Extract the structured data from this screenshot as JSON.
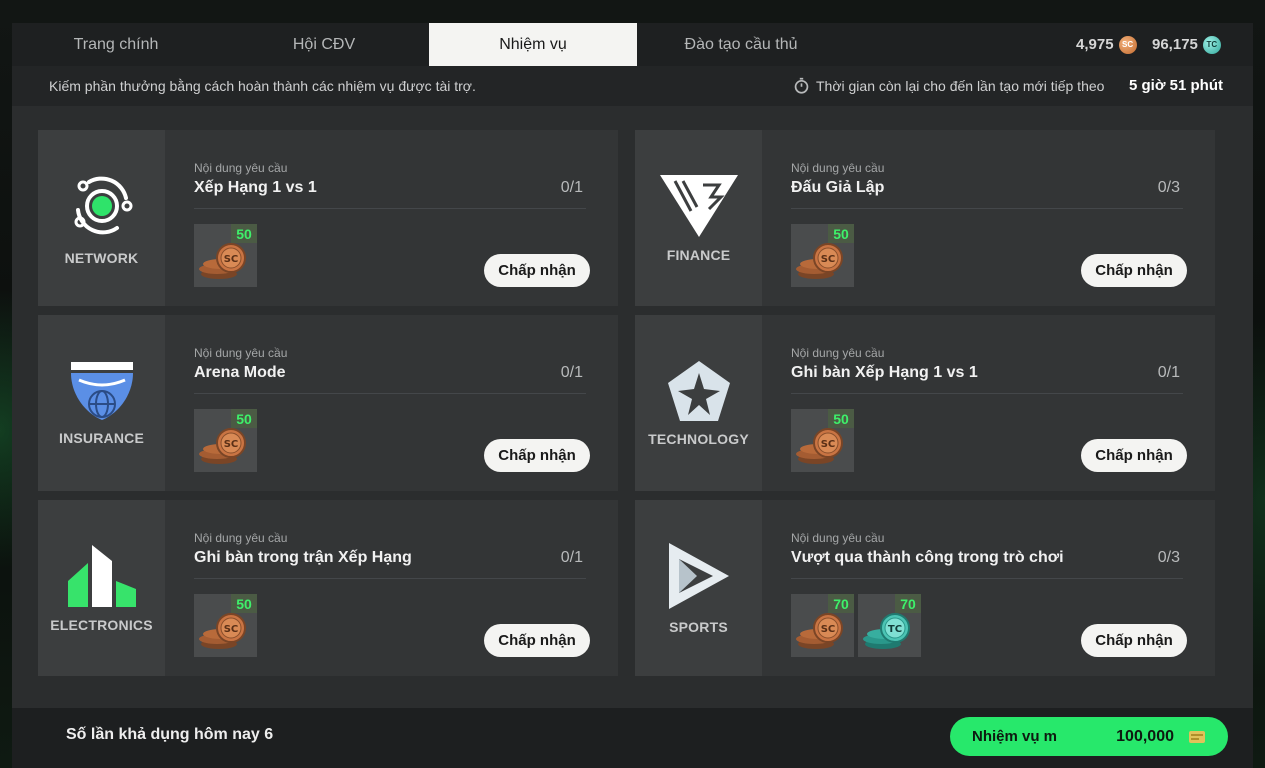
{
  "tabs": [
    {
      "label": "Trang chính"
    },
    {
      "label": "Hội CĐV"
    },
    {
      "label": "Nhiệm vụ"
    },
    {
      "label": "Đào tạo cầu thủ"
    }
  ],
  "active_tab": "Nhiệm vụ",
  "currency": {
    "sc_amount": "4,975",
    "sc_icon": "sc-coin-icon",
    "sc_symbol": "SC",
    "tc_amount": "96,175",
    "tc_icon": "tc-coin-icon",
    "tc_symbol": "TC"
  },
  "info": {
    "description": "Kiếm phần thưởng bằng cách hoàn thành các nhiệm vụ được tài trợ.",
    "timer_label": "Thời gian còn lại cho đến lần tạo mới tiếp theo",
    "timer_value": "5 giờ 51 phút"
  },
  "missions": [
    {
      "sponsor": "NETWORK",
      "req_label": "Nội dung yêu cầu",
      "title": "Xếp Hạng 1 vs 1",
      "progress": "0/1",
      "rewards": [
        {
          "type": "SC",
          "amount": "50"
        }
      ],
      "accept_label": "Chấp nhận"
    },
    {
      "sponsor": "FINANCE",
      "req_label": "Nội dung yêu cầu",
      "title": "Đấu Giả Lập",
      "progress": "0/3",
      "rewards": [
        {
          "type": "SC",
          "amount": "50"
        }
      ],
      "accept_label": "Chấp nhận"
    },
    {
      "sponsor": "INSURANCE",
      "req_label": "Nội dung yêu cầu",
      "title": "Arena Mode",
      "progress": "0/1",
      "rewards": [
        {
          "type": "SC",
          "amount": "50"
        }
      ],
      "accept_label": "Chấp nhận"
    },
    {
      "sponsor": "TECHNOLOGY",
      "req_label": "Nội dung yêu cầu",
      "title": "Ghi bàn Xếp Hạng 1 vs 1",
      "progress": "0/1",
      "rewards": [
        {
          "type": "SC",
          "amount": "50"
        }
      ],
      "accept_label": "Chấp nhận"
    },
    {
      "sponsor": "ELECTRONICS",
      "req_label": "Nội dung yêu cầu",
      "title": "Ghi bàn trong trận Xếp Hạng",
      "progress": "0/1",
      "rewards": [
        {
          "type": "SC",
          "amount": "50"
        }
      ],
      "accept_label": "Chấp nhận"
    },
    {
      "sponsor": "SPORTS",
      "req_label": "Nội dung yêu cầu",
      "title": "Vượt qua thành công trong trò chơi",
      "progress": "0/3",
      "rewards": [
        {
          "type": "SC",
          "amount": "70"
        },
        {
          "type": "TC",
          "amount": "70"
        }
      ],
      "accept_label": "Chấp nhận"
    }
  ],
  "footer": {
    "available_today": "Số lần khả dụng hôm nay 6",
    "mission_button_label": "Nhiệm vụ m",
    "mission_button_cost": "100,000",
    "cost_icon": "points-icon"
  },
  "colors": {
    "accent_green": "#27e86b",
    "reward_amount_green": "#3ef06a",
    "active_tab_bg": "#f4f4f2",
    "network_logo": "#2fe36a",
    "insurance_logo": "#5b8fe6",
    "electronics_logo": "#37e36b"
  }
}
